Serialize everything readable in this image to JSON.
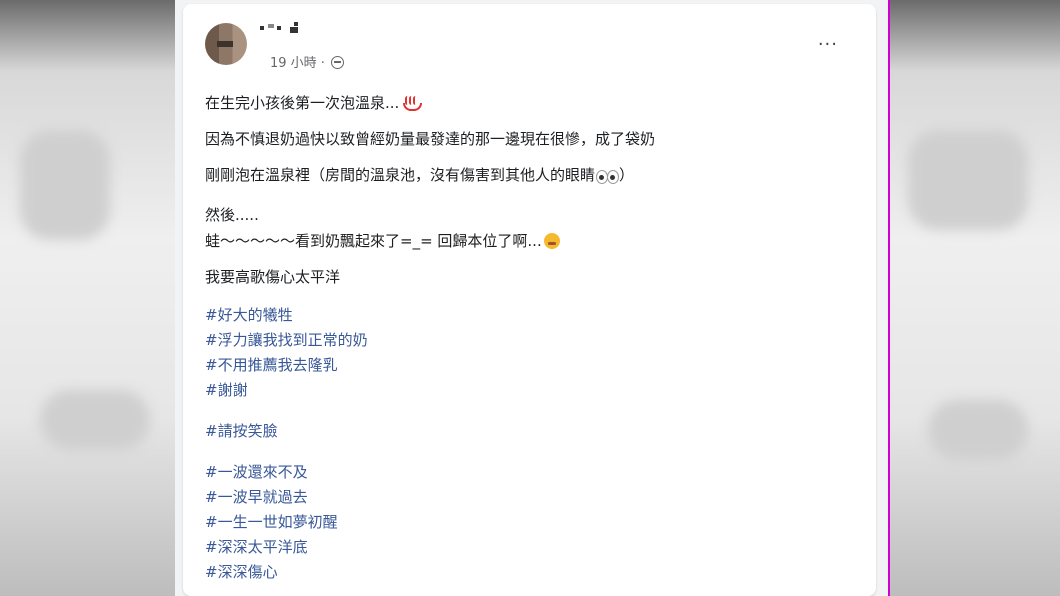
{
  "post": {
    "time": "19 小時 ·",
    "more_label": "···",
    "lines": [
      "在生完小孩後第一次泡溫泉...",
      "因為不慎退奶過快以致曾經奶量最發達的那一邊現在很慘，成了袋奶",
      "剛剛泡在溫泉裡（房間的溫泉池，沒有傷害到其他人的眼睛",
      "然後.....",
      "蛙～～～～～看到奶飄起來了=_= 回歸本位了啊...",
      "我要高歌傷心太平洋"
    ],
    "line3_suffix": "）",
    "hashtags": [
      "#好大的犧牲",
      "#浮力讓我找到正常的奶",
      "#不用推薦我去隆乳",
      "#謝謝",
      "#請按笑臉",
      "#一波還來不及",
      "#一波早就過去",
      "#一生一世如夢初醒",
      "#深深太平洋底",
      "#深深傷心"
    ]
  },
  "icons": [
    "globe-icon",
    "more-options-icon",
    "hot-springs-emoji-icon",
    "eyes-emoji-icon",
    "weary-face-emoji-icon"
  ],
  "colors": {
    "hashtag": "#385898",
    "text": "#1c1e21",
    "meta": "#65676b",
    "divider": "#d000d0"
  }
}
